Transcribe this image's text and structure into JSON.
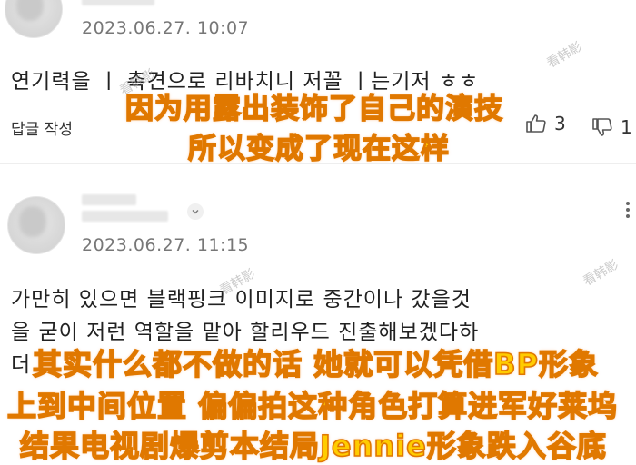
{
  "comment1": {
    "timestamp": "2023.06.27. 10:07",
    "text": "연기력을 ㅣ 촉견으로 리바치니 저꼴 ㅣ는기저 ㅎㅎ",
    "reply_label": "답글 작성",
    "like_count": "3",
    "dislike_count": "1"
  },
  "comment2": {
    "timestamp": "2023.06.27. 11:15",
    "text_lines": [
      "가만히 있으면 블랙핑크 이미지로 중간이나 갔을것",
      "을 굳이 저런 역할을 맡아 할리우드 진출해보겠다하",
      "더"
    ]
  },
  "overlay_captions": [
    "因为用露出装饰了自己的演技",
    "所以变成了现在这样",
    "其实什么都不做的话 她就可以凭借BP形象",
    "上到中间位置 偏偏拍这种角色打算进军好莱坞",
    "结果电视剧爆剪本结局Jennie形象跌入谷底"
  ],
  "watermark": "看韩影",
  "colors": {
    "caption_fill": "#ffcc00",
    "caption_stroke": "#e07800",
    "timestamp": "#777777"
  }
}
